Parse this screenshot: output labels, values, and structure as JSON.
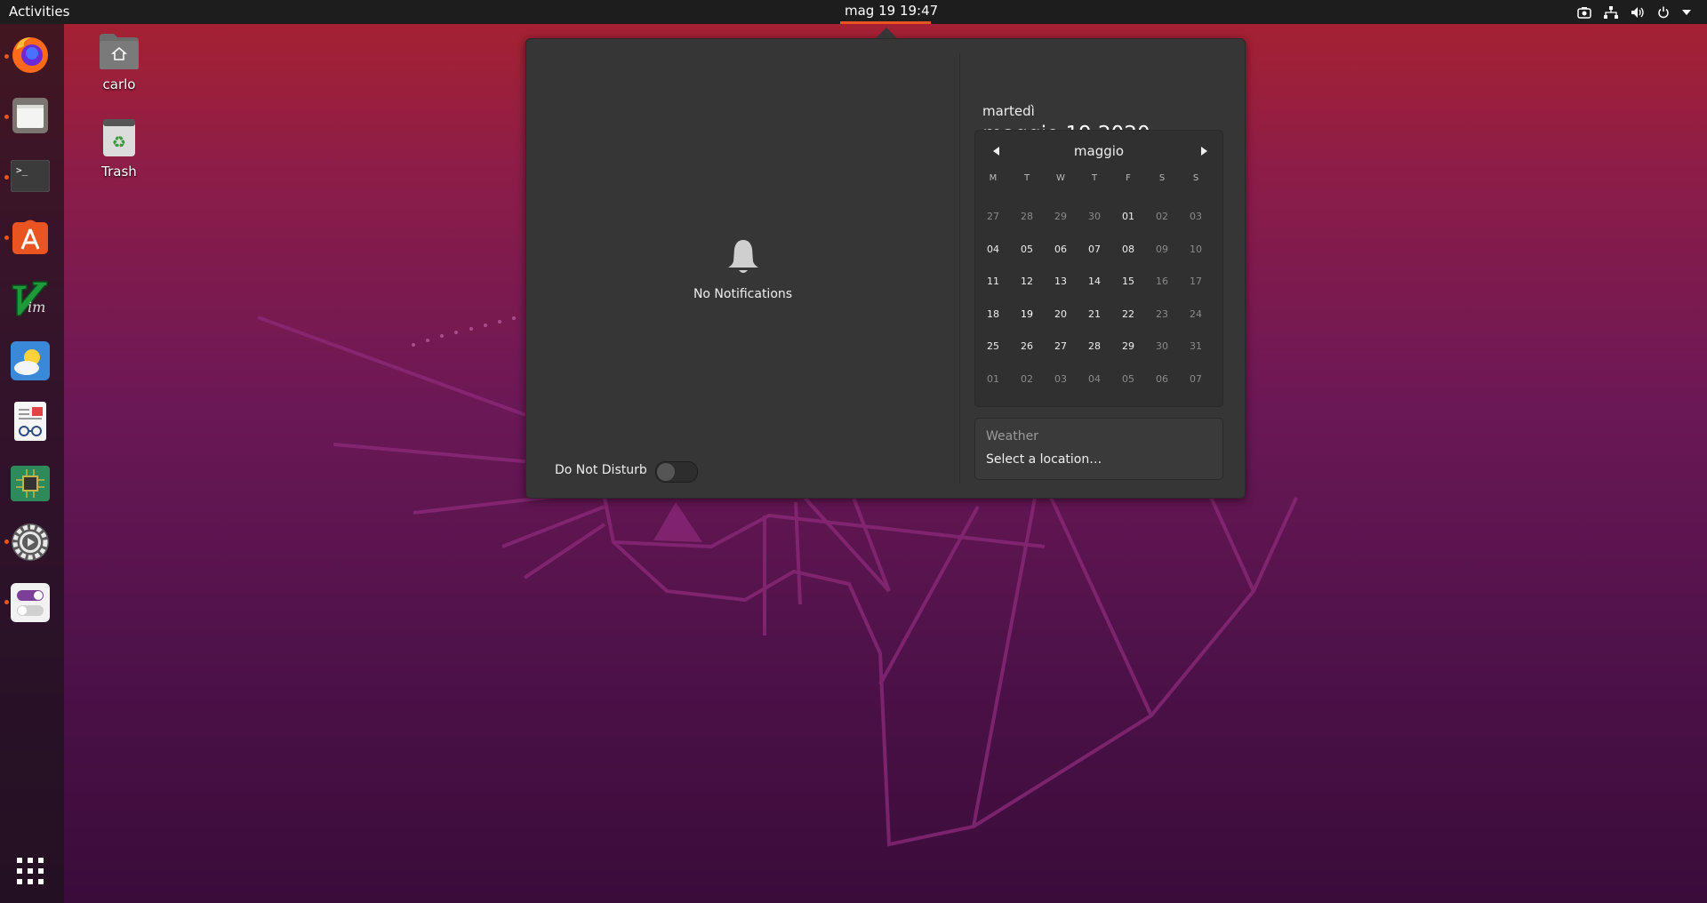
{
  "topbar": {
    "activities_label": "Activities",
    "clock_label": "mag 19  19:47",
    "tray_icons": [
      "screenshot-icon",
      "network-icon",
      "volume-icon",
      "power-icon",
      "menu-arrow-icon"
    ]
  },
  "dock": {
    "items": [
      {
        "name": "firefox",
        "running": true
      },
      {
        "name": "files",
        "running": true
      },
      {
        "name": "terminal",
        "running": true
      },
      {
        "name": "software",
        "running": true
      },
      {
        "name": "vim",
        "running": false
      },
      {
        "name": "weather",
        "running": false
      },
      {
        "name": "document-viewer",
        "running": false
      },
      {
        "name": "system-monitor",
        "running": false
      },
      {
        "name": "settings",
        "running": true
      },
      {
        "name": "tweaks",
        "running": true
      }
    ],
    "show_apps_icon": "apps-grid-icon"
  },
  "desktop": {
    "home_label": "carlo",
    "trash_label": "Trash"
  },
  "notifications": {
    "empty_label": "No Notifications",
    "dnd_label": "Do Not Disturb",
    "dnd_on": false
  },
  "calendar": {
    "day_name": "martedì",
    "full_date": "maggio 19 2020",
    "month_label": "maggio",
    "weekdays": [
      "M",
      "T",
      "W",
      "T",
      "F",
      "S",
      "S"
    ],
    "weeks": [
      [
        "27",
        "28",
        "29",
        "30",
        "01",
        "02",
        "03"
      ],
      [
        "04",
        "05",
        "06",
        "07",
        "08",
        "09",
        "10"
      ],
      [
        "11",
        "12",
        "13",
        "14",
        "15",
        "16",
        "17"
      ],
      [
        "18",
        "19",
        "20",
        "21",
        "22",
        "23",
        "24"
      ],
      [
        "25",
        "26",
        "27",
        "28",
        "29",
        "30",
        "31"
      ],
      [
        "01",
        "02",
        "03",
        "04",
        "05",
        "06",
        "07"
      ]
    ],
    "today": "19"
  },
  "weather": {
    "title": "Weather",
    "location_prompt": "Select a location…"
  },
  "colors": {
    "accent": "#e95420",
    "panel": "#363636",
    "topbar": "#1d1d1d"
  }
}
